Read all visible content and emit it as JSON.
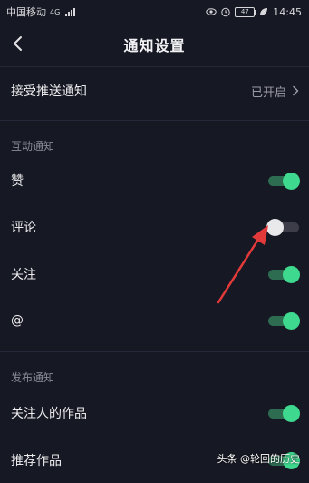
{
  "status_bar": {
    "carrier": "中国移动",
    "network": "4G",
    "battery_level": "47",
    "time": "14:45"
  },
  "header": {
    "title": "通知设置"
  },
  "push": {
    "label": "接受推送通知",
    "status": "已开启"
  },
  "interaction_section": {
    "title": "互动通知",
    "items": [
      {
        "label": "赞",
        "enabled": true
      },
      {
        "label": "评论",
        "enabled": false
      },
      {
        "label": "关注",
        "enabled": true
      },
      {
        "label": "@",
        "enabled": true
      }
    ]
  },
  "publish_section": {
    "title": "发布通知",
    "items": [
      {
        "label": "关注人的作品",
        "enabled": true
      },
      {
        "label": "推荐作品",
        "enabled": true
      }
    ]
  },
  "watermark": "头条 @轮回的历史",
  "colors": {
    "background": "#161823",
    "toggle_on": "#3ed88e",
    "toggle_off": "#e9e9ec",
    "arrow": "#e23a3a"
  },
  "icons": [
    "back-chevron-icon",
    "chevron-right-icon",
    "eye-icon",
    "alarm-icon",
    "leaf-icon",
    "battery-icon",
    "signal-icon"
  ]
}
